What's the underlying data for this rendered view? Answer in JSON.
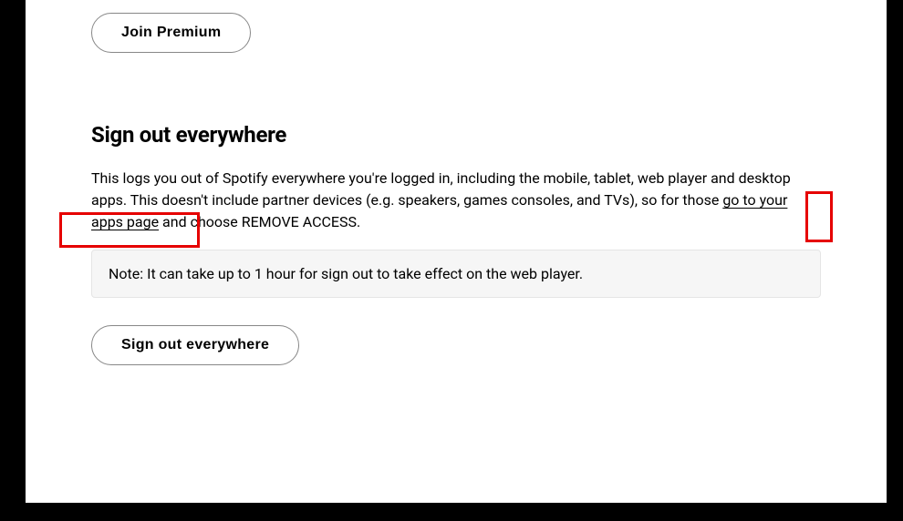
{
  "join_premium": {
    "label": "Join Premium"
  },
  "signout": {
    "heading": "Sign out everywhere",
    "desc_part1": "This logs you out of Spotify everywhere you're logged in, including the mobile, tablet, web player and desktop apps. This doesn't include partner devices (e.g. speakers, games consoles, and TVs), so for those ",
    "link_text": "go to your apps page",
    "desc_part2": " and choose REMOVE ACCESS.",
    "note": "Note: It can take up to 1 hour for sign out to take effect on the web player.",
    "button_label": "Sign out everywhere"
  }
}
